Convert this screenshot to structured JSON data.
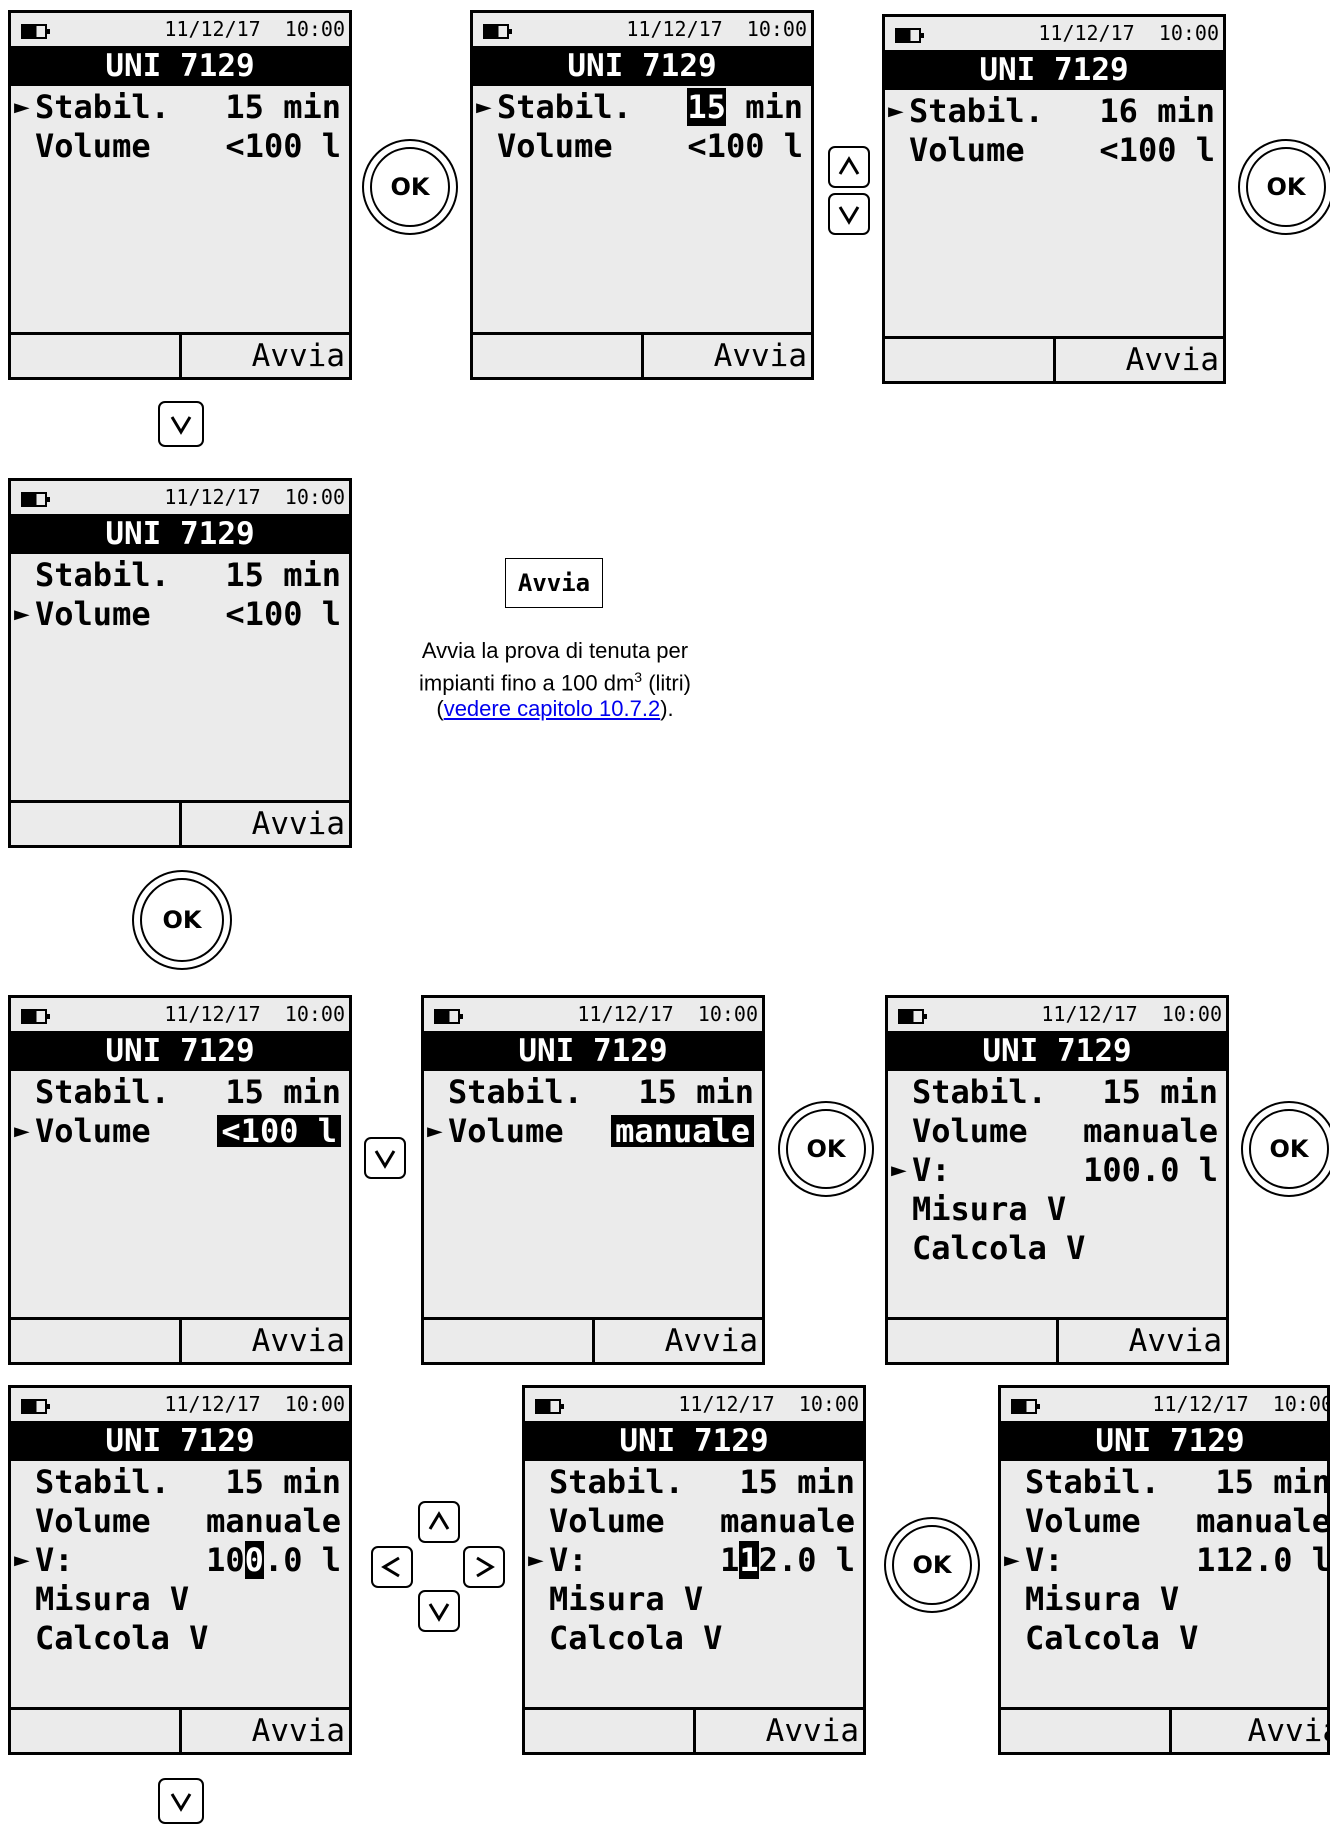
{
  "device": {
    "date": "11/12/17",
    "time": "10:00",
    "title": "UNI 7129",
    "softkey": "Avvia"
  },
  "labels": {
    "stabil": "Stabil.",
    "volume": "Volume",
    "v": "V:",
    "misura": "Misura V",
    "calcola": "Calcola V"
  },
  "values": {
    "min15": "15 min",
    "min16": "16 min",
    "vol100": "<100 l",
    "manuale": "manuale",
    "v100": "100.0 l",
    "v112": "112.0 l"
  },
  "buttons": {
    "ok": "OK"
  },
  "avvia_box": "Avvia",
  "description": {
    "line1": "Avvia la prova di tenuta per",
    "line2_pre": "impianti fino a 100 dm",
    "line2_sup": "3",
    "line2_post": " (litri)",
    "paren_open": "(",
    "link": "vedere capitolo 10.7.2",
    "paren_close": ")."
  },
  "colors": {
    "screen_bg": "#ebebeb",
    "title_bg": "#000000",
    "link": "#0000ee"
  },
  "icons": [
    "battery-icon",
    "ok-button",
    "up-arrow-key",
    "down-arrow-key",
    "left-arrow-key",
    "right-arrow-key"
  ]
}
